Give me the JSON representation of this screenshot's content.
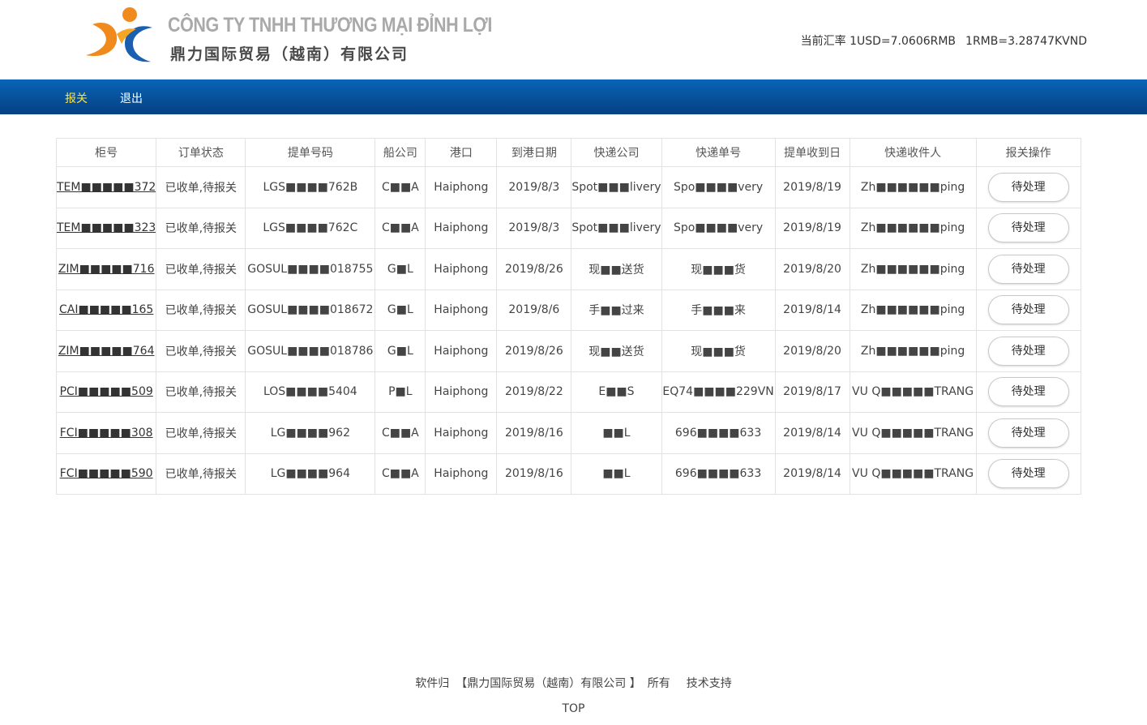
{
  "company": {
    "name_vn": "CÔNG TY TNHH THƯƠNG MẠI ĐỈNH LỢI",
    "name_cn": "鼎力国际贸易（越南）有限公司"
  },
  "exchange_rate": {
    "usd": "当前汇率 1USD=7.0606RMB",
    "rmb": "1RMB=3.28747KVND"
  },
  "nav": {
    "customs": "报关",
    "logout": "退出"
  },
  "table": {
    "headers": [
      "柜号",
      "订单状态",
      "提单号码",
      "船公司",
      "港口",
      "到港日期",
      "快递公司",
      "快递单号",
      "提单收到日",
      "快递收件人",
      "报关操作"
    ],
    "rows": [
      [
        "TEM■■■■■372",
        "已收单,待报关",
        "LGS■■■■762B",
        "C■■A",
        "Haiphong",
        "2019/8/3",
        "Spot■■■livery",
        "Spo■■■■very",
        "2019/8/19",
        "Zh■■■■■■ping",
        "待处理"
      ],
      [
        "TEM■■■■■323",
        "已收单,待报关",
        "LGS■■■■762C",
        "C■■A",
        "Haiphong",
        "2019/8/3",
        "Spot■■■livery",
        "Spo■■■■very",
        "2019/8/19",
        "Zh■■■■■■ping",
        "待处理"
      ],
      [
        "ZIM■■■■■716",
        "已收单,待报关",
        "GOSUL■■■■018755",
        "G■L",
        "Haiphong",
        "2019/8/26",
        "现■■送货",
        "现■■■货",
        "2019/8/20",
        "Zh■■■■■■ping",
        "待处理"
      ],
      [
        "CAI■■■■■165",
        "已收单,待报关",
        "GOSUL■■■■018672",
        "G■L",
        "Haiphong",
        "2019/8/6",
        "手■■过来",
        "手■■■来",
        "2019/8/14",
        "Zh■■■■■■ping",
        "待处理"
      ],
      [
        "ZIM■■■■■764",
        "已收单,待报关",
        "GOSUL■■■■018786",
        "G■L",
        "Haiphong",
        "2019/8/26",
        "现■■送货",
        "现■■■货",
        "2019/8/20",
        "Zh■■■■■■ping",
        "待处理"
      ],
      [
        "PCI■■■■■509",
        "已收单,待报关",
        "LOS■■■■5404",
        "P■L",
        "Haiphong",
        "2019/8/22",
        "E■■S",
        "EQ74■■■■229VN",
        "2019/8/17",
        "VU Q■■■■■TRANG",
        "待处理"
      ],
      [
        "FCI■■■■■308",
        "已收单,待报关",
        "LG■■■■962",
        "C■■A",
        "Haiphong",
        "2019/8/16",
        "■■L",
        "696■■■■633",
        "2019/8/14",
        "VU Q■■■■■TRANG",
        "待处理"
      ],
      [
        "FCI■■■■■590",
        "已收单,待报关",
        "LG■■■■964",
        "C■■A",
        "Haiphong",
        "2019/8/16",
        "■■L",
        "696■■■■633",
        "2019/8/14",
        "VU Q■■■■■TRANG",
        "待处理"
      ]
    ]
  },
  "footer": {
    "owner_prefix": "软件归",
    "owner_company": "【鼎力国际贸易（越南）有限公司 】",
    "owner_suffix": "所有",
    "support": "技术支持",
    "top": "TOP"
  },
  "colors": {
    "nav_bg": "#075099",
    "nav_active": "#ffe23a",
    "logo_orange": "#f08a1c",
    "logo_blue": "#1a5fb0"
  }
}
